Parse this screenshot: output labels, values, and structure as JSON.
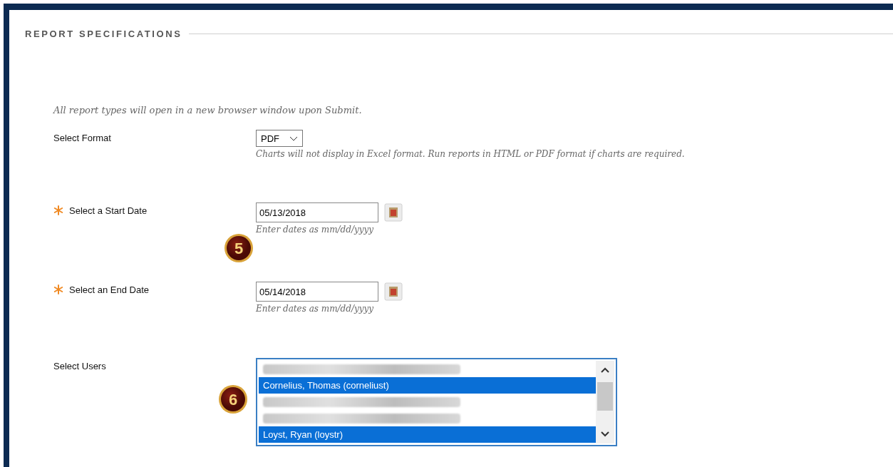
{
  "section": {
    "title": "REPORT SPECIFICATIONS"
  },
  "note": "All report types will open in a new browser window upon Submit.",
  "fields": [
    {
      "kind": "select",
      "label": "Select Format",
      "required": false,
      "value": "PDF",
      "hint": "Charts will not display in Excel format. Run reports in HTML or PDF format if charts are required."
    },
    {
      "kind": "date",
      "label": "Select a Start Date",
      "required": true,
      "value": "05/13/2018",
      "hint": "Enter dates as mm/dd/yyyy",
      "callout": "5"
    },
    {
      "kind": "date",
      "label": "Select an End Date",
      "required": true,
      "value": "05/14/2018",
      "hint": "Enter dates as mm/dd/yyyy"
    },
    {
      "kind": "listbox",
      "label": "Select Users",
      "required": false,
      "callout": "6",
      "options": [
        {
          "kind": "redacted",
          "selected": false
        },
        {
          "kind": "text",
          "text": "Cornelius, Thomas (corneliust)",
          "selected": true
        },
        {
          "kind": "redacted",
          "selected": false
        },
        {
          "kind": "redacted",
          "selected": false
        },
        {
          "kind": "text",
          "text": "Loyst, Ryan (loystr)",
          "selected": true
        }
      ]
    }
  ]
}
